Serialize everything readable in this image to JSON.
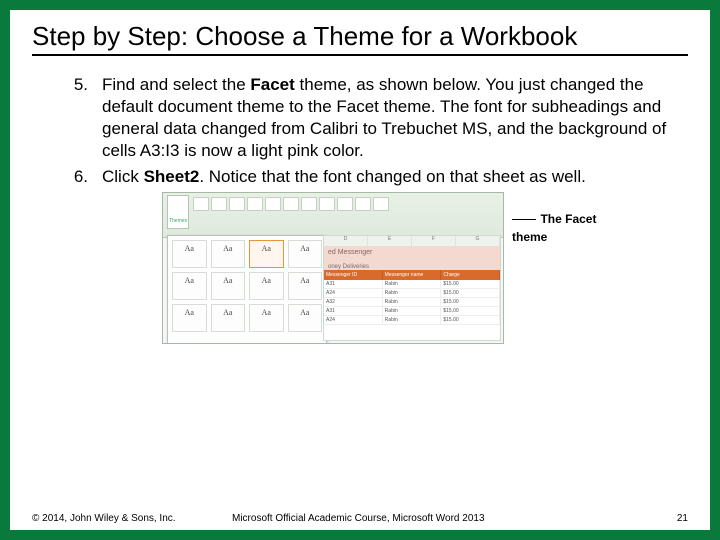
{
  "title": "Step by Step: Choose a Theme for a Workbook",
  "steps": [
    {
      "num": "5.",
      "text_before": "Find and select the ",
      "bold": "Facet",
      "text_after": " theme, as shown below. You just changed the default document theme to the Facet theme. The font for subheadings and general data changed from Calibri to Trebuchet MS, and the background of cells A3:I3 is now a light pink color."
    },
    {
      "num": "6.",
      "text_before": "Click ",
      "bold": "Sheet2",
      "text_after": ". Notice that the font changed on that sheet as well."
    }
  ],
  "figure": {
    "callout": "The Facet theme",
    "themes_label": "Themes",
    "swatch_glyph": "Aa",
    "columns": [
      "D",
      "E",
      "F",
      "G"
    ],
    "title_row": "ed Messenger",
    "title_sub": "oney Deliveries",
    "table_headers": [
      "Messenger ID",
      "Messenger name",
      "Charge"
    ],
    "rows": [
      [
        "A31",
        "Rabin",
        "$15.00"
      ],
      [
        "A24",
        "Rabin",
        "$15.00"
      ],
      [
        "A32",
        "Rabin",
        "$15.00"
      ],
      [
        "A31",
        "Rabin",
        "$15.00"
      ],
      [
        "A24",
        "Rabin",
        "$15.00"
      ]
    ]
  },
  "footer": {
    "left": "© 2014, John Wiley & Sons, Inc.",
    "mid": "Microsoft Official Academic Course, Microsoft Word 2013",
    "right": "21"
  }
}
